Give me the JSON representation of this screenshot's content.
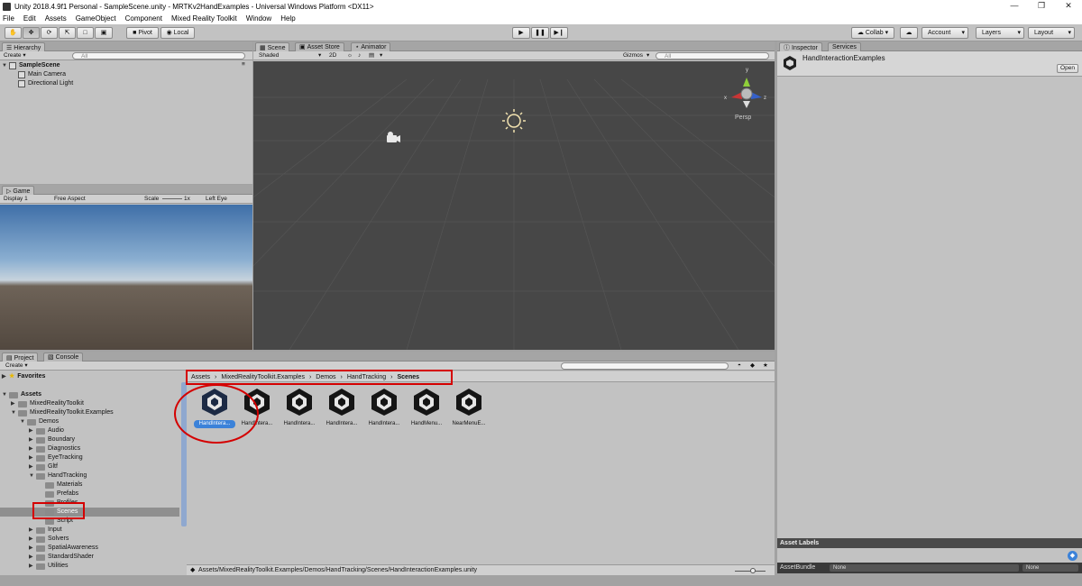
{
  "window": {
    "title": "Unity 2018.4.9f1 Personal - SampleScene.unity - MRTKv2HandExamples - Universal Windows Platform <DX11>"
  },
  "menu": [
    "File",
    "Edit",
    "Assets",
    "GameObject",
    "Component",
    "Mixed Reality Toolkit",
    "Window",
    "Help"
  ],
  "toolbar": {
    "pivot": "Pivot",
    "local": "Local",
    "collab": "Collab ▾",
    "account": "Account",
    "layers": "Layers",
    "layout": "Layout"
  },
  "hierarchy": {
    "tab": "Hierarchy",
    "create": "Create ▾",
    "search_placeholder": "All",
    "scene": "SampleScene",
    "items": [
      "Main Camera",
      "Directional Light"
    ]
  },
  "game": {
    "tab": "Game",
    "display": "Display 1",
    "aspect": "Free Aspect",
    "scale_label": "Scale",
    "scale_value": "1x",
    "eye": "Left Eye"
  },
  "scene_view": {
    "tabs": [
      "Scene",
      "Asset Store",
      "Animator"
    ],
    "shading": "Shaded",
    "mode_2d": "2D",
    "gizmos": "Gizmos",
    "search_placeholder": "All",
    "persp": "Persp",
    "axis_y": "y",
    "axis_x": "x",
    "axis_z": "z"
  },
  "inspector": {
    "tabs": [
      "Inspector",
      "Services"
    ],
    "asset_name": "HandInteractionExamples",
    "open_button": "Open",
    "asset_labels": "Asset Labels",
    "asset_bundle_label": "AssetBundle",
    "bundle_value": "None",
    "variant_value": "None"
  },
  "project": {
    "tabs": [
      "Project",
      "Console"
    ],
    "create": "Create ▾",
    "favorites": "Favorites",
    "tree": [
      {
        "label": "Assets",
        "level": 0,
        "expanded": true,
        "bold": true
      },
      {
        "label": "MixedRealityToolkit",
        "level": 1,
        "expanded": false
      },
      {
        "label": "MixedRealityToolkit.Examples",
        "level": 1,
        "expanded": true
      },
      {
        "label": "Demos",
        "level": 2,
        "expanded": true
      },
      {
        "label": "Audio",
        "level": 3,
        "expanded": false
      },
      {
        "label": "Boundary",
        "level": 3,
        "expanded": false
      },
      {
        "label": "Diagnostics",
        "level": 3,
        "expanded": false
      },
      {
        "label": "EyeTracking",
        "level": 3,
        "expanded": false
      },
      {
        "label": "Gltf",
        "level": 3,
        "expanded": false
      },
      {
        "label": "HandTracking",
        "level": 3,
        "expanded": true
      },
      {
        "label": "Materials",
        "level": 4,
        "leaf": true
      },
      {
        "label": "Prefabs",
        "level": 4,
        "leaf": true
      },
      {
        "label": "Profiles",
        "level": 4,
        "leaf": true
      },
      {
        "label": "Scenes",
        "level": 4,
        "leaf": true,
        "selected": true
      },
      {
        "label": "Script",
        "level": 4,
        "leaf": true
      },
      {
        "label": "Input",
        "level": 3,
        "expanded": false
      },
      {
        "label": "Solvers",
        "level": 3,
        "expanded": false
      },
      {
        "label": "SpatialAwareness",
        "level": 3,
        "expanded": false
      },
      {
        "label": "StandardShader",
        "level": 3,
        "expanded": false
      },
      {
        "label": "Utilities",
        "level": 3,
        "expanded": false
      }
    ],
    "breadcrumb": [
      "Assets",
      "MixedRealityToolkit.Examples",
      "Demos",
      "HandTracking",
      "Scenes"
    ],
    "assets": [
      "HandIntera...",
      "HandIntera...",
      "HandIntera...",
      "HandIntera...",
      "HandIntera...",
      "HandMenu...",
      "NearMenuE..."
    ],
    "status_path": "Assets/MixedRealityToolkit.Examples/Demos/HandTracking/Scenes/HandInteractionExamples.unity",
    "search_placeholder": ""
  },
  "colors": {
    "highlight": "#d40000",
    "selection": "#3b82d9",
    "scene_bg": "#474747"
  }
}
